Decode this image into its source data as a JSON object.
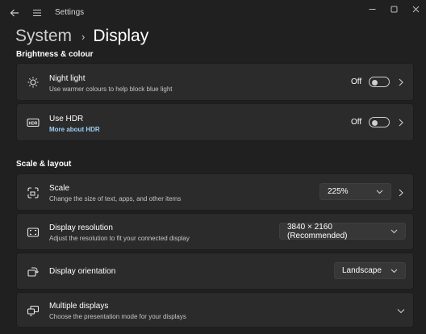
{
  "app": {
    "title": "Settings"
  },
  "breadcrumb": {
    "parent": "System",
    "separator": "›",
    "current": "Display"
  },
  "sections": {
    "brightness": "Brightness & colour",
    "scale_layout": "Scale & layout"
  },
  "night_light": {
    "title": "Night light",
    "subtitle": "Use warmer colours to help block blue light",
    "state": "Off",
    "icon": "brightness-icon"
  },
  "hdr": {
    "title": "Use HDR",
    "link": "More about HDR",
    "state": "Off",
    "icon": "hdr-icon"
  },
  "scale": {
    "title": "Scale",
    "subtitle": "Change the size of text, apps, and other items",
    "value": "225%",
    "icon": "scale-icon"
  },
  "resolution": {
    "title": "Display resolution",
    "subtitle": "Adjust the resolution to fit your connected display",
    "value": "3840 × 2160 (Recommended)",
    "icon": "resolution-icon"
  },
  "orientation": {
    "title": "Display orientation",
    "value": "Landscape",
    "icon": "orientation-icon"
  },
  "multiple": {
    "title": "Multiple displays",
    "subtitle": "Choose the presentation mode for your displays",
    "icon": "multiple-displays-icon"
  },
  "colors": {
    "background": "#202020",
    "card": "#2b2b2b",
    "link": "#9bd0f5",
    "dropdown": "#373737"
  }
}
